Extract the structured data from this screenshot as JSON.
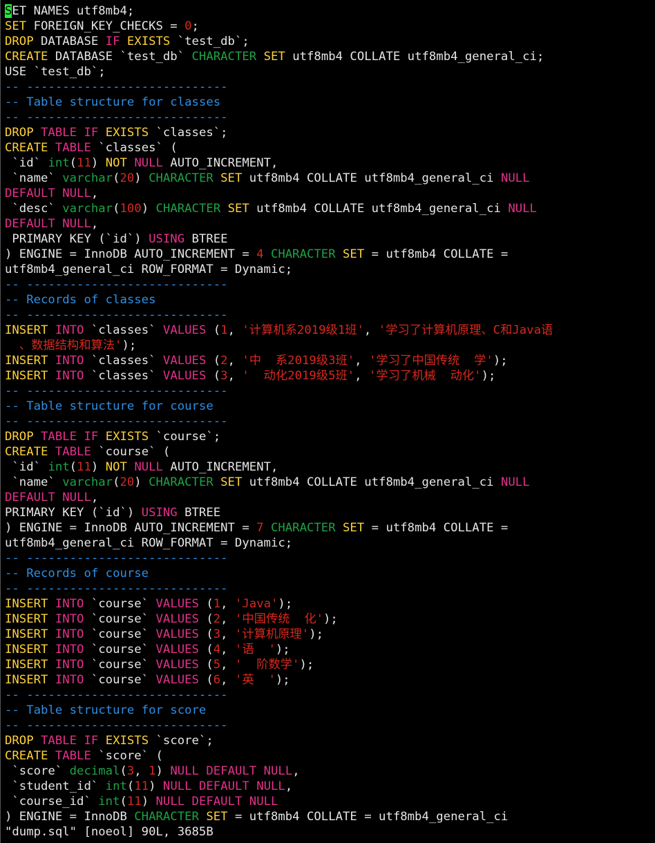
{
  "editor": {
    "lines": [
      [
        [
          "cursor",
          "S"
        ],
        [
          "p",
          "ET NAMES utf8mb4;"
        ]
      ],
      [
        [
          "kw",
          "SET"
        ],
        [
          "p",
          " FOREIGN_KEY_CHECKS = "
        ],
        [
          "rd",
          "0"
        ],
        [
          "p",
          ";"
        ]
      ],
      [
        [
          "kw",
          "DROP"
        ],
        [
          "p",
          " DATABASE "
        ],
        [
          "kp",
          "IF"
        ],
        [
          "p",
          " "
        ],
        [
          "kw",
          "EXISTS"
        ],
        [
          "p",
          " `test_db`;"
        ]
      ],
      [
        [
          "kw",
          "CREATE"
        ],
        [
          "p",
          " DATABASE `test_db` "
        ],
        [
          "gr",
          "CHARACTER"
        ],
        [
          "p",
          " "
        ],
        [
          "kw",
          "SET"
        ],
        [
          "p",
          " utf8mb4 COLLATE utf8mb4_general_ci;"
        ]
      ],
      [
        [
          "p",
          "USE `test_db`;"
        ]
      ],
      [
        [
          "cm",
          "-- ----------------------------"
        ]
      ],
      [
        [
          "cm",
          "-- Table structure for classes"
        ]
      ],
      [
        [
          "cm",
          "-- ----------------------------"
        ]
      ],
      [
        [
          "kw",
          "DROP"
        ],
        [
          "p",
          " "
        ],
        [
          "kp",
          "TABLE"
        ],
        [
          "p",
          " "
        ],
        [
          "kp",
          "IF"
        ],
        [
          "p",
          " "
        ],
        [
          "kw",
          "EXISTS"
        ],
        [
          "p",
          " `classes`;"
        ]
      ],
      [
        [
          "kw",
          "CREATE"
        ],
        [
          "p",
          " "
        ],
        [
          "kp",
          "TABLE"
        ],
        [
          "p",
          " `classes` ("
        ]
      ],
      [
        [
          "p",
          " `id` "
        ],
        [
          "gr",
          "int"
        ],
        [
          "p",
          "("
        ],
        [
          "rd",
          "11"
        ],
        [
          "p",
          ") "
        ],
        [
          "kw",
          "NOT"
        ],
        [
          "p",
          " "
        ],
        [
          "kp",
          "NULL"
        ],
        [
          "p",
          " AUTO_INCREMENT,"
        ]
      ],
      [
        [
          "p",
          " `name` "
        ],
        [
          "gr",
          "varchar"
        ],
        [
          "p",
          "("
        ],
        [
          "rd",
          "20"
        ],
        [
          "p",
          ") "
        ],
        [
          "gr",
          "CHARACTER"
        ],
        [
          "p",
          " "
        ],
        [
          "kw",
          "SET"
        ],
        [
          "p",
          " utf8mb4 COLLATE utf8mb4_general_ci "
        ],
        [
          "kp",
          "NULL"
        ]
      ],
      [
        [
          "kp",
          "DEFAULT"
        ],
        [
          "p",
          " "
        ],
        [
          "kp",
          "NULL"
        ],
        [
          "p",
          ","
        ]
      ],
      [
        [
          "p",
          " `desc` "
        ],
        [
          "gr",
          "varchar"
        ],
        [
          "p",
          "("
        ],
        [
          "rd",
          "100"
        ],
        [
          "p",
          ") "
        ],
        [
          "gr",
          "CHARACTER"
        ],
        [
          "p",
          " "
        ],
        [
          "kw",
          "SET"
        ],
        [
          "p",
          " utf8mb4 COLLATE utf8mb4_general_ci "
        ],
        [
          "kp",
          "NULL"
        ]
      ],
      [
        [
          "kp",
          "DEFAULT"
        ],
        [
          "p",
          " "
        ],
        [
          "kp",
          "NULL"
        ],
        [
          "p",
          ","
        ]
      ],
      [
        [
          "p",
          " PRIMARY KEY (`id`) "
        ],
        [
          "kp",
          "USING"
        ],
        [
          "p",
          " BTREE"
        ]
      ],
      [
        [
          "p",
          ") ENGINE = InnoDB AUTO_INCREMENT = "
        ],
        [
          "rd",
          "4"
        ],
        [
          "p",
          " "
        ],
        [
          "gr",
          "CHARACTER"
        ],
        [
          "p",
          " "
        ],
        [
          "kw",
          "SET"
        ],
        [
          "p",
          " = utf8mb4 COLLATE ="
        ]
      ],
      [
        [
          "p",
          "utf8mb4_general_ci ROW_FORMAT = Dynamic;"
        ]
      ],
      [
        [
          "cm",
          "-- ----------------------------"
        ]
      ],
      [
        [
          "cm",
          "-- Records of classes"
        ]
      ],
      [
        [
          "cm",
          "-- ----------------------------"
        ]
      ],
      [
        [
          "kw",
          "INSERT"
        ],
        [
          "p",
          " "
        ],
        [
          "kp",
          "INTO"
        ],
        [
          "p",
          " `classes` "
        ],
        [
          "kp",
          "VALUES"
        ],
        [
          "p",
          " ("
        ],
        [
          "rd",
          "1"
        ],
        [
          "p",
          ", "
        ],
        [
          "rd",
          "'计算机系2019级1班'"
        ],
        [
          "p",
          ", "
        ],
        [
          "rd",
          "'学习了计算机原理、C和Java语"
        ]
      ],
      [
        [
          "rd",
          "  、数据结构和算法'"
        ],
        [
          "p",
          ");"
        ]
      ],
      [
        [
          "kw",
          "INSERT"
        ],
        [
          "p",
          " "
        ],
        [
          "kp",
          "INTO"
        ],
        [
          "p",
          " `classes` "
        ],
        [
          "kp",
          "VALUES"
        ],
        [
          "p",
          " ("
        ],
        [
          "rd",
          "2"
        ],
        [
          "p",
          ", "
        ],
        [
          "rd",
          "'中  系2019级3班'"
        ],
        [
          "p",
          ", "
        ],
        [
          "rd",
          "'学习了中国传统  学'"
        ],
        [
          "p",
          ");"
        ]
      ],
      [
        [
          "kw",
          "INSERT"
        ],
        [
          "p",
          " "
        ],
        [
          "kp",
          "INTO"
        ],
        [
          "p",
          " `classes` "
        ],
        [
          "kp",
          "VALUES"
        ],
        [
          "p",
          " ("
        ],
        [
          "rd",
          "3"
        ],
        [
          "p",
          ", "
        ],
        [
          "rd",
          "'  动化2019级5班'"
        ],
        [
          "p",
          ", "
        ],
        [
          "rd",
          "'学习了机械  动化'"
        ],
        [
          "p",
          ");"
        ]
      ],
      [
        [
          "cm",
          "-- ----------------------------"
        ]
      ],
      [
        [
          "cm",
          "-- Table structure for course"
        ]
      ],
      [
        [
          "cm",
          "-- ----------------------------"
        ]
      ],
      [
        [
          "kw",
          "DROP"
        ],
        [
          "p",
          " "
        ],
        [
          "kp",
          "TABLE"
        ],
        [
          "p",
          " "
        ],
        [
          "kp",
          "IF"
        ],
        [
          "p",
          " "
        ],
        [
          "kw",
          "EXISTS"
        ],
        [
          "p",
          " `course`;"
        ]
      ],
      [
        [
          "kw",
          "CREATE"
        ],
        [
          "p",
          " "
        ],
        [
          "kp",
          "TABLE"
        ],
        [
          "p",
          " `course` ("
        ]
      ],
      [
        [
          "p",
          " `id` "
        ],
        [
          "gr",
          "int"
        ],
        [
          "p",
          "("
        ],
        [
          "rd",
          "11"
        ],
        [
          "p",
          ") "
        ],
        [
          "kw",
          "NOT"
        ],
        [
          "p",
          " "
        ],
        [
          "kp",
          "NULL"
        ],
        [
          "p",
          " AUTO_INCREMENT,"
        ]
      ],
      [
        [
          "p",
          " `name` "
        ],
        [
          "gr",
          "varchar"
        ],
        [
          "p",
          "("
        ],
        [
          "rd",
          "20"
        ],
        [
          "p",
          ") "
        ],
        [
          "gr",
          "CHARACTER"
        ],
        [
          "p",
          " "
        ],
        [
          "kw",
          "SET"
        ],
        [
          "p",
          " utf8mb4 COLLATE utf8mb4_general_ci "
        ],
        [
          "kp",
          "NULL"
        ]
      ],
      [
        [
          "kp",
          "DEFAULT"
        ],
        [
          "p",
          " "
        ],
        [
          "kp",
          "NULL"
        ],
        [
          "p",
          ","
        ]
      ],
      [
        [
          "p",
          "PRIMARY KEY (`id`) "
        ],
        [
          "kp",
          "USING"
        ],
        [
          "p",
          " BTREE"
        ]
      ],
      [
        [
          "p",
          ") ENGINE = InnoDB AUTO_INCREMENT = "
        ],
        [
          "rd",
          "7"
        ],
        [
          "p",
          " "
        ],
        [
          "gr",
          "CHARACTER"
        ],
        [
          "p",
          " "
        ],
        [
          "kw",
          "SET"
        ],
        [
          "p",
          " = utf8mb4 COLLATE ="
        ]
      ],
      [
        [
          "p",
          "utf8mb4_general_ci ROW_FORMAT = Dynamic;"
        ]
      ],
      [
        [
          "cm",
          "-- ----------------------------"
        ]
      ],
      [
        [
          "cm",
          "-- Records of course"
        ]
      ],
      [
        [
          "cm",
          "-- ----------------------------"
        ]
      ],
      [
        [
          "kw",
          "INSERT"
        ],
        [
          "p",
          " "
        ],
        [
          "kp",
          "INTO"
        ],
        [
          "p",
          " `course` "
        ],
        [
          "kp",
          "VALUES"
        ],
        [
          "p",
          " ("
        ],
        [
          "rd",
          "1"
        ],
        [
          "p",
          ", "
        ],
        [
          "rd",
          "'Java'"
        ],
        [
          "p",
          ");"
        ]
      ],
      [
        [
          "kw",
          "INSERT"
        ],
        [
          "p",
          " "
        ],
        [
          "kp",
          "INTO"
        ],
        [
          "p",
          " `course` "
        ],
        [
          "kp",
          "VALUES"
        ],
        [
          "p",
          " ("
        ],
        [
          "rd",
          "2"
        ],
        [
          "p",
          ", "
        ],
        [
          "rd",
          "'中国传统  化'"
        ],
        [
          "p",
          ");"
        ]
      ],
      [
        [
          "kw",
          "INSERT"
        ],
        [
          "p",
          " "
        ],
        [
          "kp",
          "INTO"
        ],
        [
          "p",
          " `course` "
        ],
        [
          "kp",
          "VALUES"
        ],
        [
          "p",
          " ("
        ],
        [
          "rd",
          "3"
        ],
        [
          "p",
          ", "
        ],
        [
          "rd",
          "'计算机原理'"
        ],
        [
          "p",
          ");"
        ]
      ],
      [
        [
          "kw",
          "INSERT"
        ],
        [
          "p",
          " "
        ],
        [
          "kp",
          "INTO"
        ],
        [
          "p",
          " `course` "
        ],
        [
          "kp",
          "VALUES"
        ],
        [
          "p",
          " ("
        ],
        [
          "rd",
          "4"
        ],
        [
          "p",
          ", "
        ],
        [
          "rd",
          "'语  '"
        ],
        [
          "p",
          ");"
        ]
      ],
      [
        [
          "kw",
          "INSERT"
        ],
        [
          "p",
          " "
        ],
        [
          "kp",
          "INTO"
        ],
        [
          "p",
          " `course` "
        ],
        [
          "kp",
          "VALUES"
        ],
        [
          "p",
          " ("
        ],
        [
          "rd",
          "5"
        ],
        [
          "p",
          ", "
        ],
        [
          "rd",
          "'  阶数学'"
        ],
        [
          "p",
          ");"
        ]
      ],
      [
        [
          "kw",
          "INSERT"
        ],
        [
          "p",
          " "
        ],
        [
          "kp",
          "INTO"
        ],
        [
          "p",
          " `course` "
        ],
        [
          "kp",
          "VALUES"
        ],
        [
          "p",
          " ("
        ],
        [
          "rd",
          "6"
        ],
        [
          "p",
          ", "
        ],
        [
          "rd",
          "'英  '"
        ],
        [
          "p",
          ");"
        ]
      ],
      [
        [
          "cm",
          "-- ----------------------------"
        ]
      ],
      [
        [
          "cm",
          "-- Table structure for score"
        ]
      ],
      [
        [
          "cm",
          "-- ----------------------------"
        ]
      ],
      [
        [
          "kw",
          "DROP"
        ],
        [
          "p",
          " "
        ],
        [
          "kp",
          "TABLE"
        ],
        [
          "p",
          " "
        ],
        [
          "kp",
          "IF"
        ],
        [
          "p",
          " "
        ],
        [
          "kw",
          "EXISTS"
        ],
        [
          "p",
          " `score`;"
        ]
      ],
      [
        [
          "kw",
          "CREATE"
        ],
        [
          "p",
          " "
        ],
        [
          "kp",
          "TABLE"
        ],
        [
          "p",
          " `score` ("
        ]
      ],
      [
        [
          "p",
          " `score` "
        ],
        [
          "gr",
          "decimal"
        ],
        [
          "p",
          "("
        ],
        [
          "rd",
          "3"
        ],
        [
          "p",
          ", "
        ],
        [
          "rd",
          "1"
        ],
        [
          "p",
          ") "
        ],
        [
          "kp",
          "NULL"
        ],
        [
          "p",
          " "
        ],
        [
          "kp",
          "DEFAULT"
        ],
        [
          "p",
          " "
        ],
        [
          "kp",
          "NULL"
        ],
        [
          "p",
          ","
        ]
      ],
      [
        [
          "p",
          " `student_id` "
        ],
        [
          "gr",
          "int"
        ],
        [
          "p",
          "("
        ],
        [
          "rd",
          "11"
        ],
        [
          "p",
          ") "
        ],
        [
          "kp",
          "NULL"
        ],
        [
          "p",
          " "
        ],
        [
          "kp",
          "DEFAULT"
        ],
        [
          "p",
          " "
        ],
        [
          "kp",
          "NULL"
        ],
        [
          "p",
          ","
        ]
      ],
      [
        [
          "p",
          " `course_id` "
        ],
        [
          "gr",
          "int"
        ],
        [
          "p",
          "("
        ],
        [
          "rd",
          "11"
        ],
        [
          "p",
          ") "
        ],
        [
          "kp",
          "NULL"
        ],
        [
          "p",
          " "
        ],
        [
          "kp",
          "DEFAULT"
        ],
        [
          "p",
          " "
        ],
        [
          "kp",
          "NULL"
        ]
      ],
      [
        [
          "p",
          ") ENGINE = InnoDB "
        ],
        [
          "gr",
          "CHARACTER"
        ],
        [
          "p",
          " "
        ],
        [
          "kw",
          "SET"
        ],
        [
          "p",
          " = utf8mb4 COLLATE = utf8mb4_general_ci"
        ]
      ]
    ],
    "status_line": "\"dump.sql\" [noeol] 90L, 3685B"
  }
}
